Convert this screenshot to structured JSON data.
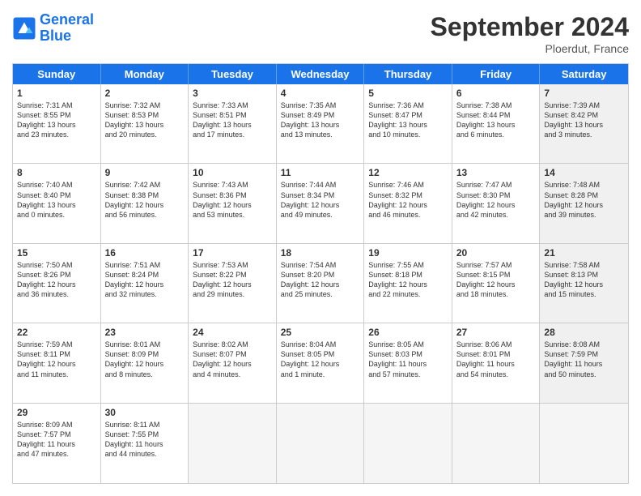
{
  "header": {
    "logo_line1": "General",
    "logo_line2": "Blue",
    "month": "September 2024",
    "location": "Ploerdut, France"
  },
  "weekdays": [
    "Sunday",
    "Monday",
    "Tuesday",
    "Wednesday",
    "Thursday",
    "Friday",
    "Saturday"
  ],
  "rows": [
    [
      {
        "day": "",
        "text": "",
        "empty": true
      },
      {
        "day": "",
        "text": "",
        "empty": true
      },
      {
        "day": "",
        "text": "",
        "empty": true
      },
      {
        "day": "",
        "text": "",
        "empty": true
      },
      {
        "day": "",
        "text": "",
        "empty": true
      },
      {
        "day": "",
        "text": "",
        "empty": true
      },
      {
        "day": "",
        "text": "",
        "empty": true
      }
    ],
    [
      {
        "day": "1",
        "text": "Sunrise: 7:31 AM\nSunset: 8:55 PM\nDaylight: 13 hours\nand 23 minutes.",
        "empty": false,
        "shaded": false
      },
      {
        "day": "2",
        "text": "Sunrise: 7:32 AM\nSunset: 8:53 PM\nDaylight: 13 hours\nand 20 minutes.",
        "empty": false,
        "shaded": false
      },
      {
        "day": "3",
        "text": "Sunrise: 7:33 AM\nSunset: 8:51 PM\nDaylight: 13 hours\nand 17 minutes.",
        "empty": false,
        "shaded": false
      },
      {
        "day": "4",
        "text": "Sunrise: 7:35 AM\nSunset: 8:49 PM\nDaylight: 13 hours\nand 13 minutes.",
        "empty": false,
        "shaded": false
      },
      {
        "day": "5",
        "text": "Sunrise: 7:36 AM\nSunset: 8:47 PM\nDaylight: 13 hours\nand 10 minutes.",
        "empty": false,
        "shaded": false
      },
      {
        "day": "6",
        "text": "Sunrise: 7:38 AM\nSunset: 8:44 PM\nDaylight: 13 hours\nand 6 minutes.",
        "empty": false,
        "shaded": false
      },
      {
        "day": "7",
        "text": "Sunrise: 7:39 AM\nSunset: 8:42 PM\nDaylight: 13 hours\nand 3 minutes.",
        "empty": false,
        "shaded": true
      }
    ],
    [
      {
        "day": "8",
        "text": "Sunrise: 7:40 AM\nSunset: 8:40 PM\nDaylight: 13 hours\nand 0 minutes.",
        "empty": false,
        "shaded": false
      },
      {
        "day": "9",
        "text": "Sunrise: 7:42 AM\nSunset: 8:38 PM\nDaylight: 12 hours\nand 56 minutes.",
        "empty": false,
        "shaded": false
      },
      {
        "day": "10",
        "text": "Sunrise: 7:43 AM\nSunset: 8:36 PM\nDaylight: 12 hours\nand 53 minutes.",
        "empty": false,
        "shaded": false
      },
      {
        "day": "11",
        "text": "Sunrise: 7:44 AM\nSunset: 8:34 PM\nDaylight: 12 hours\nand 49 minutes.",
        "empty": false,
        "shaded": false
      },
      {
        "day": "12",
        "text": "Sunrise: 7:46 AM\nSunset: 8:32 PM\nDaylight: 12 hours\nand 46 minutes.",
        "empty": false,
        "shaded": false
      },
      {
        "day": "13",
        "text": "Sunrise: 7:47 AM\nSunset: 8:30 PM\nDaylight: 12 hours\nand 42 minutes.",
        "empty": false,
        "shaded": false
      },
      {
        "day": "14",
        "text": "Sunrise: 7:48 AM\nSunset: 8:28 PM\nDaylight: 12 hours\nand 39 minutes.",
        "empty": false,
        "shaded": true
      }
    ],
    [
      {
        "day": "15",
        "text": "Sunrise: 7:50 AM\nSunset: 8:26 PM\nDaylight: 12 hours\nand 36 minutes.",
        "empty": false,
        "shaded": false
      },
      {
        "day": "16",
        "text": "Sunrise: 7:51 AM\nSunset: 8:24 PM\nDaylight: 12 hours\nand 32 minutes.",
        "empty": false,
        "shaded": false
      },
      {
        "day": "17",
        "text": "Sunrise: 7:53 AM\nSunset: 8:22 PM\nDaylight: 12 hours\nand 29 minutes.",
        "empty": false,
        "shaded": false
      },
      {
        "day": "18",
        "text": "Sunrise: 7:54 AM\nSunset: 8:20 PM\nDaylight: 12 hours\nand 25 minutes.",
        "empty": false,
        "shaded": false
      },
      {
        "day": "19",
        "text": "Sunrise: 7:55 AM\nSunset: 8:18 PM\nDaylight: 12 hours\nand 22 minutes.",
        "empty": false,
        "shaded": false
      },
      {
        "day": "20",
        "text": "Sunrise: 7:57 AM\nSunset: 8:15 PM\nDaylight: 12 hours\nand 18 minutes.",
        "empty": false,
        "shaded": false
      },
      {
        "day": "21",
        "text": "Sunrise: 7:58 AM\nSunset: 8:13 PM\nDaylight: 12 hours\nand 15 minutes.",
        "empty": false,
        "shaded": true
      }
    ],
    [
      {
        "day": "22",
        "text": "Sunrise: 7:59 AM\nSunset: 8:11 PM\nDaylight: 12 hours\nand 11 minutes.",
        "empty": false,
        "shaded": false
      },
      {
        "day": "23",
        "text": "Sunrise: 8:01 AM\nSunset: 8:09 PM\nDaylight: 12 hours\nand 8 minutes.",
        "empty": false,
        "shaded": false
      },
      {
        "day": "24",
        "text": "Sunrise: 8:02 AM\nSunset: 8:07 PM\nDaylight: 12 hours\nand 4 minutes.",
        "empty": false,
        "shaded": false
      },
      {
        "day": "25",
        "text": "Sunrise: 8:04 AM\nSunset: 8:05 PM\nDaylight: 12 hours\nand 1 minute.",
        "empty": false,
        "shaded": false
      },
      {
        "day": "26",
        "text": "Sunrise: 8:05 AM\nSunset: 8:03 PM\nDaylight: 11 hours\nand 57 minutes.",
        "empty": false,
        "shaded": false
      },
      {
        "day": "27",
        "text": "Sunrise: 8:06 AM\nSunset: 8:01 PM\nDaylight: 11 hours\nand 54 minutes.",
        "empty": false,
        "shaded": false
      },
      {
        "day": "28",
        "text": "Sunrise: 8:08 AM\nSunset: 7:59 PM\nDaylight: 11 hours\nand 50 minutes.",
        "empty": false,
        "shaded": true
      }
    ],
    [
      {
        "day": "29",
        "text": "Sunrise: 8:09 AM\nSunset: 7:57 PM\nDaylight: 11 hours\nand 47 minutes.",
        "empty": false,
        "shaded": false
      },
      {
        "day": "30",
        "text": "Sunrise: 8:11 AM\nSunset: 7:55 PM\nDaylight: 11 hours\nand 44 minutes.",
        "empty": false,
        "shaded": false
      },
      {
        "day": "",
        "text": "",
        "empty": true
      },
      {
        "day": "",
        "text": "",
        "empty": true
      },
      {
        "day": "",
        "text": "",
        "empty": true
      },
      {
        "day": "",
        "text": "",
        "empty": true
      },
      {
        "day": "",
        "text": "",
        "empty": true
      }
    ]
  ]
}
